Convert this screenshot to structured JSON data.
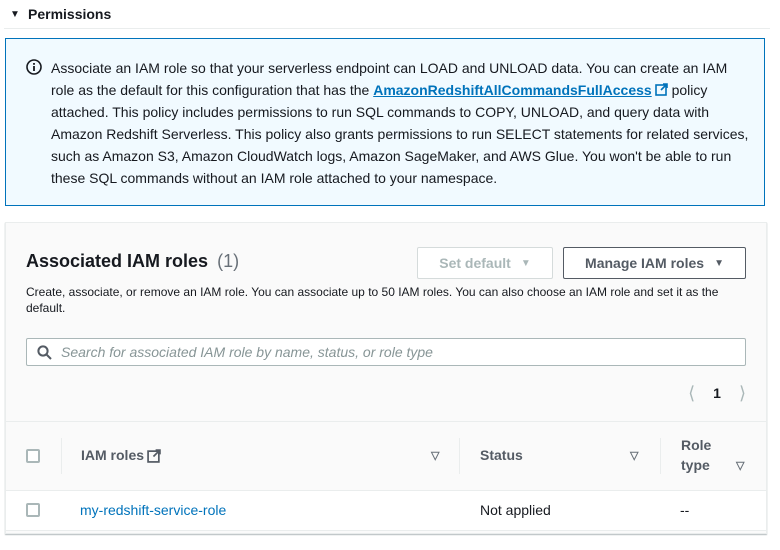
{
  "permissions": {
    "header": "Permissions"
  },
  "info": {
    "text_before": "Associate an IAM role so that your serverless endpoint can LOAD and UNLOAD data. You can create an IAM role as the default for this configuration that has the ",
    "link": "AmazonRedshiftAllCommandsFullAccess",
    "text_after": " policy attached. This policy includes permissions to run SQL commands to COPY, UNLOAD, and query data with Amazon Redshift Serverless. This policy also grants permissions to run SELECT statements for related services, such as Amazon S3, Amazon CloudWatch logs, Amazon SageMaker, and AWS Glue. You won't be able to run these SQL commands without an IAM role attached to your namespace."
  },
  "roles_panel": {
    "title": "Associated IAM roles",
    "count": "(1)",
    "description": "Create, associate, or remove an IAM role. You can associate up to 50 IAM roles. You can also choose an IAM role and set it as the default.",
    "set_default_label": "Set default",
    "manage_label": "Manage IAM roles",
    "search_placeholder": "Search for associated IAM role by name, status, or role type",
    "page": "1"
  },
  "table": {
    "columns": {
      "roles": "IAM roles",
      "status": "Status",
      "role_type_line1": "Role",
      "role_type_line2": "type"
    },
    "rows": [
      {
        "name": "my-redshift-service-role",
        "status": "Not applied",
        "role_type": "--"
      }
    ]
  }
}
